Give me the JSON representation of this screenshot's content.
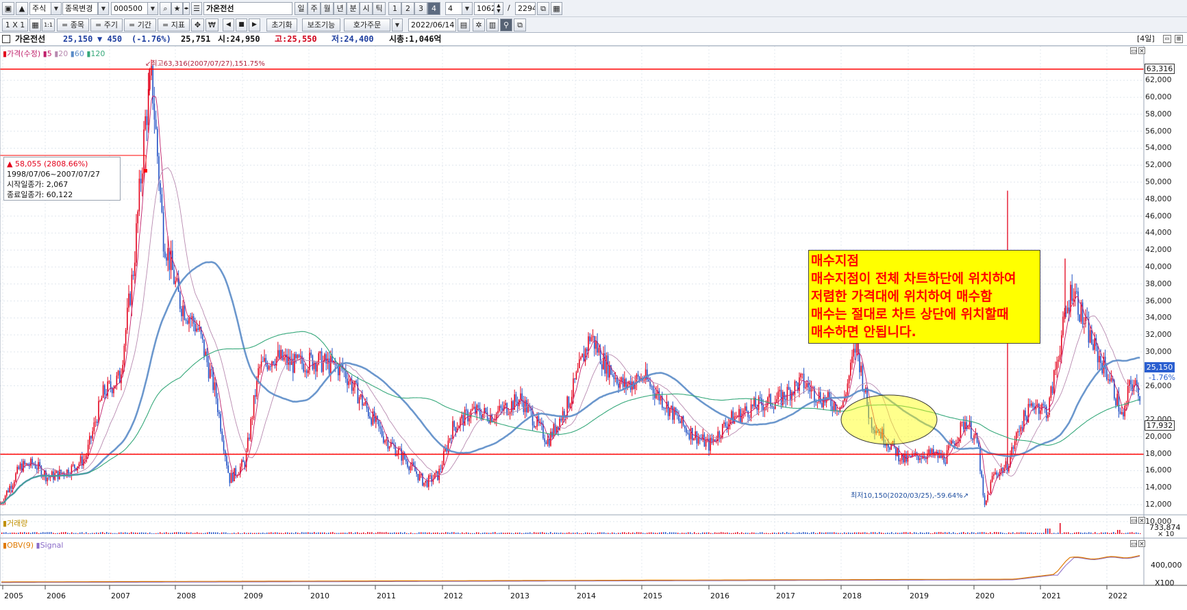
{
  "toolbar": {
    "market_label": "주식",
    "change_label": "종목변경",
    "code_value": "000500",
    "stock_name": "가온전선",
    "periods": [
      "일",
      "주",
      "월",
      "년",
      "분",
      "시",
      "틱",
      "1",
      "2",
      "3",
      "4"
    ],
    "active_period": "4",
    "period_value": "4",
    "count_value": "1062",
    "slash": "/",
    "total_value": "2294",
    "layout_label": "1 X 1",
    "btn_stock": "= 종목",
    "btn_period": "= 주기",
    "btn_term": "= 기간",
    "btn_indicator": "= 지표",
    "reset_label": "초기화",
    "assist_label": "보조기능",
    "order_label": "호가주문",
    "date_value": "2022/06/14"
  },
  "info": {
    "name": "가온전선",
    "price": "25,150",
    "change": "▼ 450",
    "change_pct": "(-1.76%)",
    "volume": "25,751",
    "open_label": "시:24,950",
    "high_label": "고:25,550",
    "low_label": "저:24,400",
    "cap_label": "시총:1,046억",
    "period_tag": "[4일]"
  },
  "price_pane": {
    "legend_title": "가격(수정)",
    "legend_ma": [
      "5",
      "20",
      "60",
      "120"
    ],
    "high_note": "최고63,316(2007/07/27),151.75%",
    "low_note": "최저10,150(2020/03/25),-59.64%",
    "high_tag": "63,316",
    "support_tag": "17,932",
    "current_tag": "25,150",
    "current_pct": "-1.76%",
    "y_ticks": [
      "62,000",
      "60,000",
      "58,000",
      "56,000",
      "54,000",
      "52,000",
      "50,000",
      "48,000",
      "46,000",
      "44,000",
      "42,000",
      "40,000",
      "38,000",
      "36,000",
      "34,000",
      "32,000",
      "30,000",
      "28,000",
      "26,000",
      "22,000",
      "20,000",
      "18,000",
      "16,000",
      "14,000",
      "12,000",
      "10,000"
    ],
    "measure_box": {
      "line1": "▲ 58,055 (2808.66%)",
      "line2": "1998/07/06~2007/07/27",
      "line3": "시작일종가: 2,067",
      "line4": "종료일종가: 60,122"
    },
    "annotation": [
      "매수지점",
      "매수지점이 전체 차트하단에 위치하여",
      "저렴한 가격대에 위치하여 매수함",
      "매수는 절대로 차트 상단에 위치할때",
      "매수하면 안됩니다."
    ]
  },
  "volume_pane": {
    "legend": "거래량",
    "y_tick": "733,874",
    "unit": "× 10"
  },
  "obv_pane": {
    "legend_obv": "OBV(9)",
    "legend_signal": "Signal",
    "y_tick": "400,000",
    "unit": "X100"
  },
  "x_axis": {
    "years": [
      "2005",
      "2006",
      "2007",
      "2008",
      "2009",
      "2010",
      "2011",
      "2012",
      "2013",
      "2014",
      "2015",
      "2016",
      "2017",
      "2018",
      "2019",
      "2020",
      "2021",
      "2022"
    ]
  },
  "colors": {
    "up": "#e3001b",
    "down": "#1f4fc4",
    "ma5": "#c0206b",
    "ma20": "#b88ab0",
    "ma60": "#5b8cc8",
    "ma120": "#35a87a",
    "hline": "#ff0000"
  }
}
